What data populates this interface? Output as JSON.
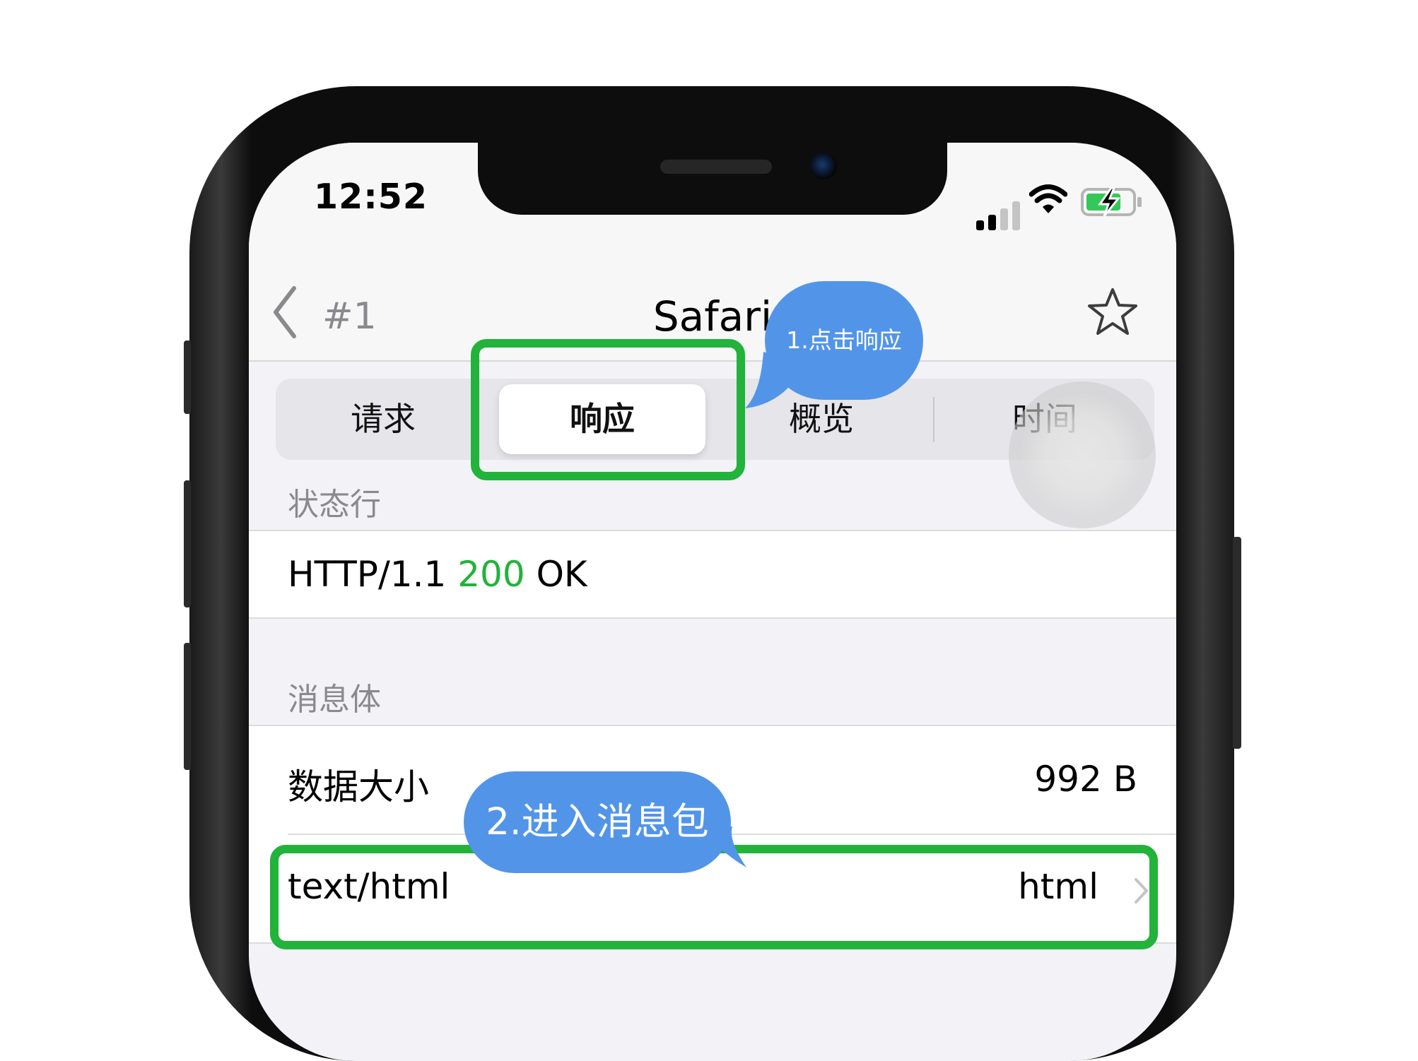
{
  "status_bar": {
    "time": "12:52"
  },
  "nav": {
    "back_label": "#1",
    "title": "Safari"
  },
  "segments": [
    "请求",
    "响应",
    "概览",
    "时间"
  ],
  "active_segment": 1,
  "status_section": {
    "header": "状态行",
    "protocol": "HTTP/1.1",
    "code": "200",
    "reason": "OK"
  },
  "body_section": {
    "header": "消息体",
    "size_label": "数据大小",
    "size_value": "992 B",
    "type_label": "text/html",
    "type_value": "html"
  },
  "annotations": {
    "step1": "1.点击响应",
    "step2": "2.进入消息包"
  },
  "colors": {
    "highlight": "#21b33a",
    "bubble": "#5295e8",
    "status_code": "#21b33a"
  },
  "icons": [
    "chevron-left-icon",
    "star-icon",
    "chevron-right-icon",
    "signal-icon",
    "wifi-icon",
    "battery-charging-icon"
  ]
}
